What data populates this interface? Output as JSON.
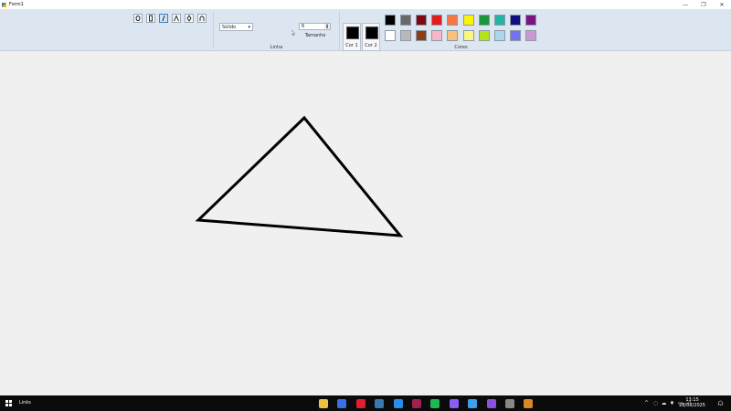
{
  "window": {
    "title": "Form1",
    "controls": {
      "minimize": "—",
      "maximize": "❐",
      "close": "✕"
    }
  },
  "ribbon": {
    "tools": [
      {
        "name": "ellipse-tool",
        "icon": "ellipse-icon",
        "active": false
      },
      {
        "name": "rectangle-tool",
        "icon": "rectangle-icon",
        "active": false
      },
      {
        "name": "line-tool",
        "icon": "line-icon",
        "active": true
      },
      {
        "name": "triangle-tool",
        "icon": "triangle-icon",
        "active": false
      },
      {
        "name": "rhombus-tool",
        "icon": "rhombus-icon",
        "active": false
      },
      {
        "name": "curve-tool",
        "icon": "curve-icon",
        "active": false
      }
    ],
    "line_style": {
      "value": "Sólido"
    },
    "size": {
      "value": "6",
      "label": "Tamanho"
    },
    "group_linha": "Linha",
    "color1": {
      "label": "Cor 1",
      "value": "#000000"
    },
    "color2": {
      "label": "Cor 2",
      "value": "#000000"
    },
    "group_cores": "Cores",
    "palette_row1": [
      "#000000",
      "#696969",
      "#7b0a14",
      "#e31c20",
      "#f57846",
      "#fcf30a",
      "#1c9638",
      "#27b3a4",
      "#0f0f80",
      "#7b1483"
    ],
    "palette_row2": [
      "#ffffff",
      "#b9b9b9",
      "#8b3d17",
      "#f8b6c7",
      "#fbc17c",
      "#faf681",
      "#b3e31a",
      "#a9d6ea",
      "#7272f2",
      "#cb98d6"
    ]
  },
  "drawing": {
    "stroke_color": "#000000",
    "stroke_width": 6
  },
  "taskbar": {
    "search_label": "Links",
    "apps": [
      {
        "name": "file-explorer-icon",
        "color": "#f0c040"
      },
      {
        "name": "browser-icon",
        "color": "#3b6ee8"
      },
      {
        "name": "opera-icon",
        "color": "#e01e2d"
      },
      {
        "name": "steam-icon",
        "color": "#3a78b0"
      },
      {
        "name": "vscode-icon",
        "color": "#2a8ee8"
      },
      {
        "name": "app-icon",
        "color": "#a02050"
      },
      {
        "name": "spotify-icon",
        "color": "#1db954"
      },
      {
        "name": "github-icon",
        "color": "#8a5cf5"
      },
      {
        "name": "mail-icon",
        "color": "#3ea0e8"
      },
      {
        "name": "visual-studio-icon",
        "color": "#8a4fe0"
      },
      {
        "name": "chrome-icon",
        "color": "#888888"
      },
      {
        "name": "paint-app-icon",
        "color": "#d9852a"
      }
    ],
    "clock": {
      "time": "13:15",
      "date": "28/03/2025"
    }
  }
}
